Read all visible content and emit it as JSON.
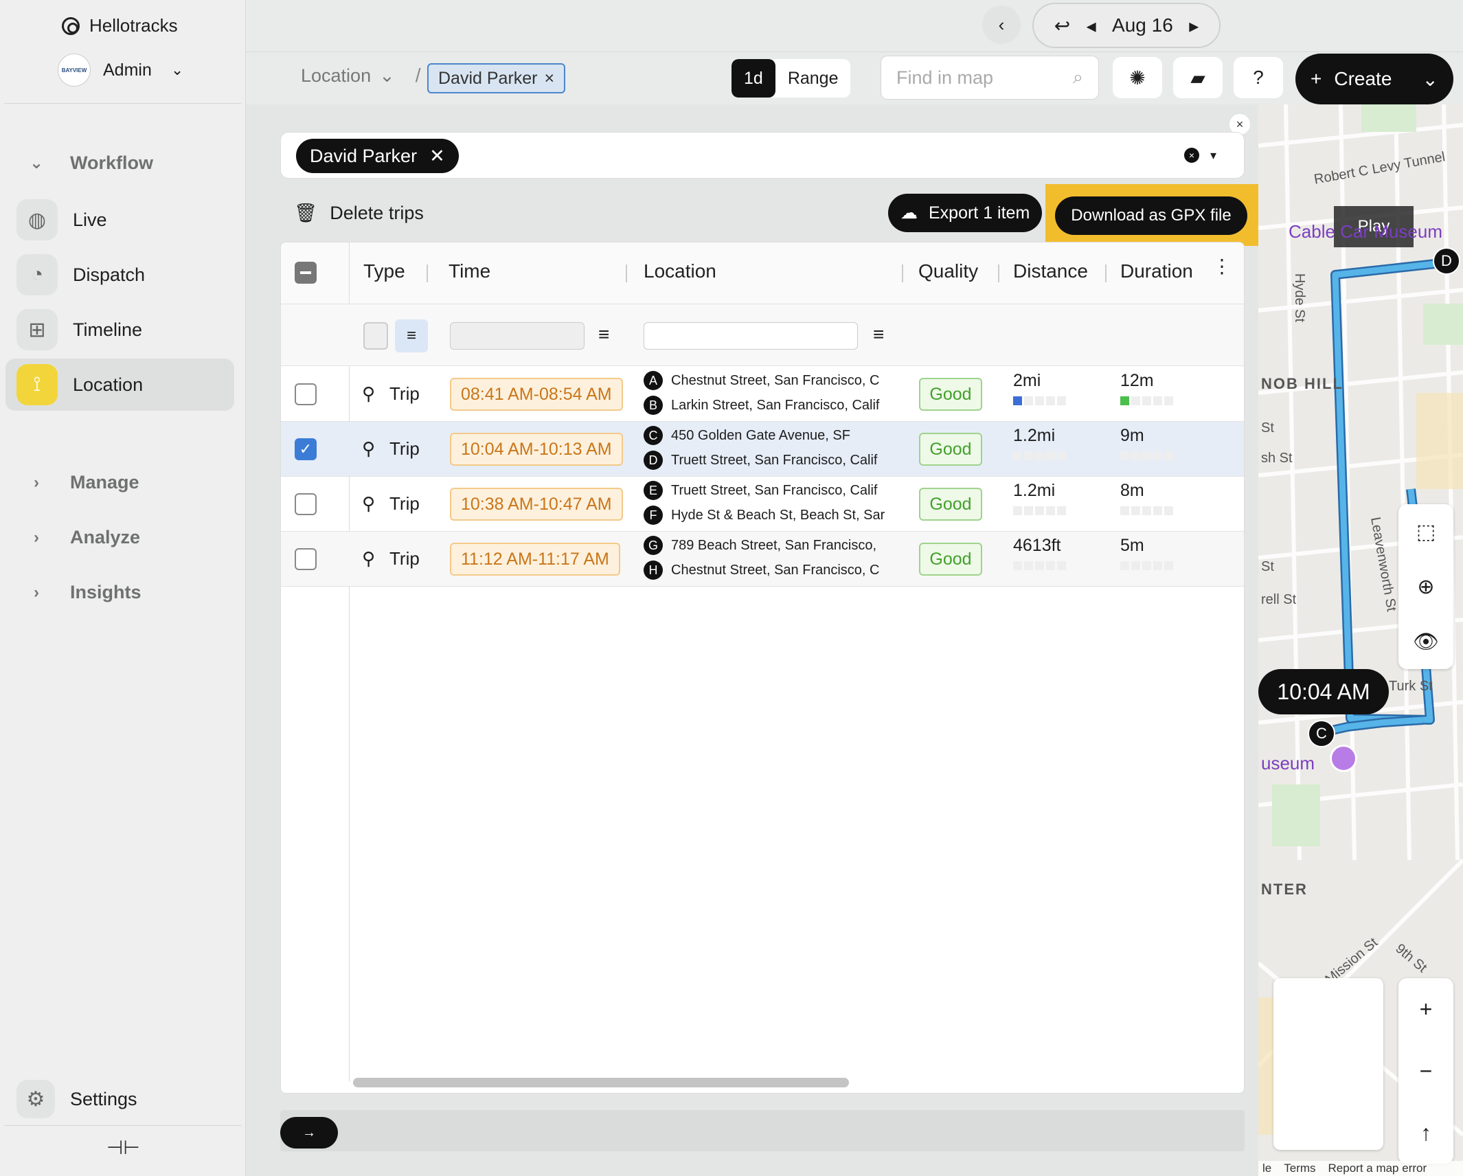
{
  "app": {
    "brand": "Hellotracks",
    "account": "Admin",
    "avatar_text": "BAYVIEW"
  },
  "sidebar": {
    "groups": {
      "workflow": "Workflow",
      "manage": "Manage",
      "analyze": "Analyze",
      "insights": "Insights"
    },
    "items": [
      {
        "label": "Live",
        "icon": "globe-icon"
      },
      {
        "label": "Dispatch",
        "icon": "dispatch-icon"
      },
      {
        "label": "Timeline",
        "icon": "timeline-icon"
      },
      {
        "label": "Location",
        "icon": "route-icon",
        "active": true
      }
    ],
    "settings": "Settings"
  },
  "datebar": {
    "date": "Aug 16"
  },
  "toolbar": {
    "breadcrumb": "Location",
    "chip": "David Parker",
    "seg_1d": "1d",
    "seg_range": "Range",
    "find_placeholder": "Find in map",
    "help": "?",
    "create": "Create"
  },
  "filter": {
    "driver": "David Parker"
  },
  "actions": {
    "delete_trips": "Delete trips",
    "export": "Export 1 item",
    "download_gpx": "Download as GPX file"
  },
  "table": {
    "columns": [
      "Type",
      "Time",
      "Location",
      "Quality",
      "Distance",
      "Duration"
    ],
    "rows": [
      {
        "type": "Trip",
        "time": "08:41 AM-08:54 AM",
        "from_marker": "A",
        "from": "Chestnut Street, San Francisco, C",
        "to_marker": "B",
        "to": "Larkin Street, San Francisco, Calif",
        "quality": "Good",
        "distance": "2mi",
        "duration": "12m",
        "checked": false
      },
      {
        "type": "Trip",
        "time": "10:04 AM-10:13 AM",
        "from_marker": "C",
        "from": "450 Golden Gate Avenue, SF",
        "to_marker": "D",
        "to": "Truett Street, San Francisco, Calif",
        "quality": "Good",
        "distance": "1.2mi",
        "duration": "9m",
        "checked": true
      },
      {
        "type": "Trip",
        "time": "10:38 AM-10:47 AM",
        "from_marker": "E",
        "from": "Truett Street, San Francisco, Calif",
        "to_marker": "F",
        "to": "Hyde St & Beach St, Beach St, Sar",
        "quality": "Good",
        "distance": "1.2mi",
        "duration": "8m",
        "checked": false
      },
      {
        "type": "Trip",
        "time": "11:12 AM-11:17 AM",
        "from_marker": "G",
        "from": "789 Beach Street, San Francisco,",
        "to_marker": "H",
        "to": "Chestnut Street, San Francisco, C",
        "quality": "Good",
        "distance": "4613ft",
        "duration": "5m",
        "checked": false
      }
    ]
  },
  "map": {
    "labels": {
      "tunnel": "Robert C Levy Tunnel",
      "museum": "Cable Car Museum",
      "hyde": "Hyde St",
      "nob_hill": "NOB HILL",
      "leavenworth": "Leavenworth St",
      "turk": "Turk St",
      "useum": "useum",
      "nter": "NTER",
      "mission": "Mission St",
      "ninth": "9th St",
      "st1": "St",
      "st2": "sh St",
      "st3": "St",
      "st4": "rell St"
    },
    "play": "Play",
    "time_tip": "10:04 AM",
    "pin_c": "C",
    "pin_d": "D",
    "footer": [
      "le",
      "Terms",
      "Report a map error"
    ],
    "route_color": "#56b4e9"
  }
}
